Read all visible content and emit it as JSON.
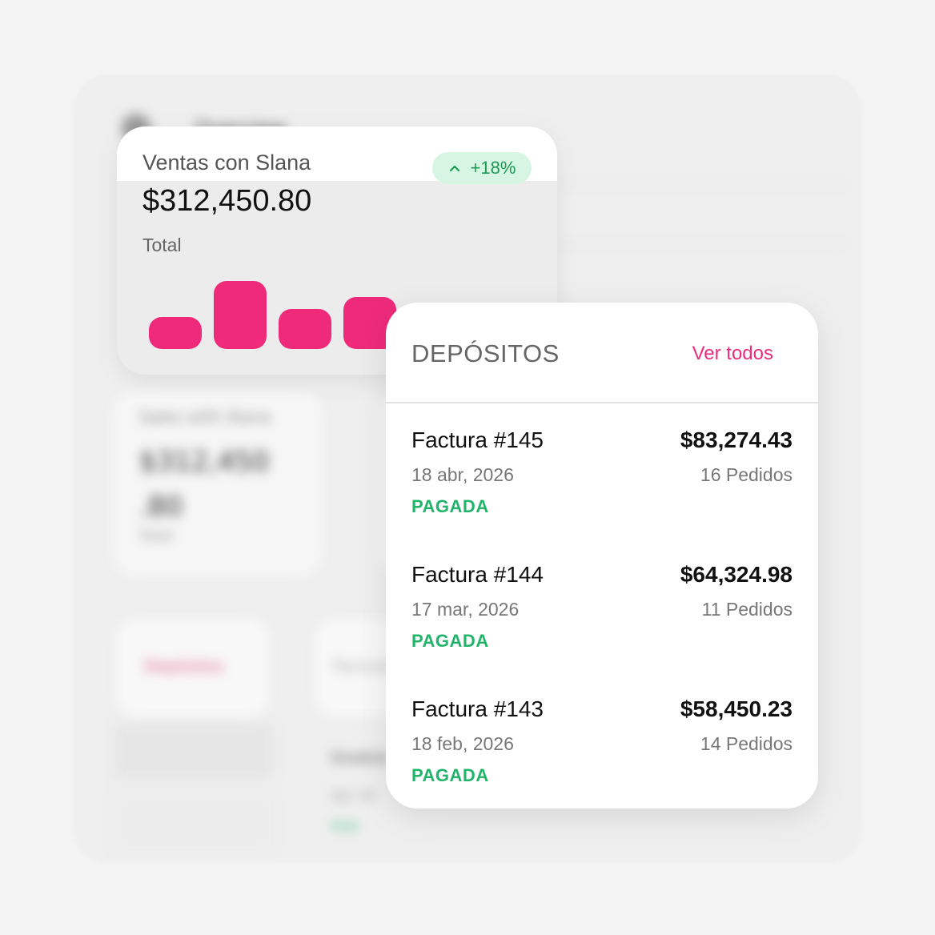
{
  "background": {
    "header_title": "Overview",
    "card": {
      "label": "Sales with Slana",
      "value": "$312,450 .80",
      "sub": "Total"
    },
    "tabs": [
      "Depósitos",
      "Facturas"
    ],
    "row_title": "Invoice",
    "row_sub": "Apr 18",
    "row_status": "Paid"
  },
  "sales": {
    "title": "Ventas con Slana",
    "badge": "+18%",
    "value": "$312,450.80",
    "sub": "Total",
    "accent": "#ef2a7b",
    "bars": [
      0.4,
      0.85,
      0.5,
      0.65
    ]
  },
  "deposits": {
    "title": "DEPÓSITOS",
    "link": "Ver todos",
    "items": [
      {
        "name": "Factura #145",
        "amount": "$83,274.43",
        "date": "18 abr, 2026",
        "orders": "16 Pedidos",
        "status": "PAGADA"
      },
      {
        "name": "Factura #144",
        "amount": "$64,324.98",
        "date": "17 mar, 2026",
        "orders": "11 Pedidos",
        "status": "PAGADA"
      },
      {
        "name": "Factura #143",
        "amount": "$58,450.23",
        "date": "18 feb, 2026",
        "orders": "14 Pedidos",
        "status": "PAGADA"
      }
    ]
  }
}
